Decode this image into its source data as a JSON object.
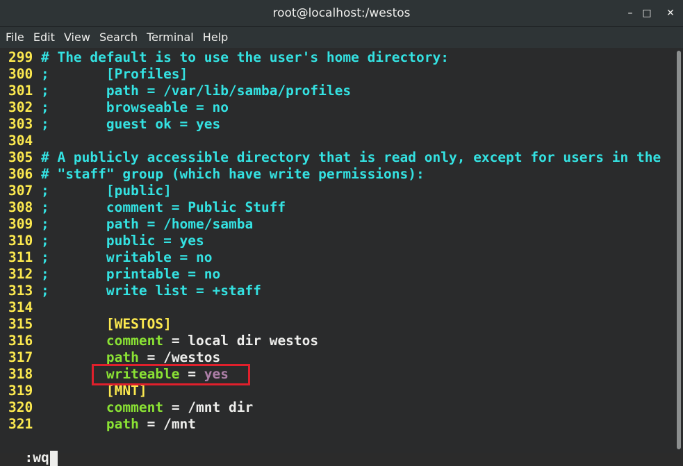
{
  "window": {
    "title": "root@localhost:/westos"
  },
  "menu": [
    "File",
    "Edit",
    "View",
    "Search",
    "Terminal",
    "Help"
  ],
  "lines": [
    {
      "n": "299",
      "segs": [
        {
          "t": "# The default is to use the user's home directory:",
          "c": "comment"
        }
      ]
    },
    {
      "n": "300",
      "segs": [
        {
          "t": ";       [Profiles]",
          "c": "comment"
        }
      ]
    },
    {
      "n": "301",
      "segs": [
        {
          "t": ";       path = /var/lib/samba/profiles",
          "c": "comment"
        }
      ]
    },
    {
      "n": "302",
      "segs": [
        {
          "t": ";       browseable = no",
          "c": "comment"
        }
      ]
    },
    {
      "n": "303",
      "segs": [
        {
          "t": ";       guest ok = yes",
          "c": "comment"
        }
      ]
    },
    {
      "n": "304",
      "segs": []
    },
    {
      "n": "305",
      "segs": [
        {
          "t": "# A publicly accessible directory that is read only, except for users in the",
          "c": "comment"
        }
      ]
    },
    {
      "n": "306",
      "segs": [
        {
          "t": "# \"staff\" group (which have write permissions):",
          "c": "comment"
        }
      ]
    },
    {
      "n": "307",
      "segs": [
        {
          "t": ";       [public]",
          "c": "comment"
        }
      ]
    },
    {
      "n": "308",
      "segs": [
        {
          "t": ";       comment = Public Stuff",
          "c": "comment"
        }
      ]
    },
    {
      "n": "309",
      "segs": [
        {
          "t": ";       path = /home/samba",
          "c": "comment"
        }
      ]
    },
    {
      "n": "310",
      "segs": [
        {
          "t": ";       public = yes",
          "c": "comment"
        }
      ]
    },
    {
      "n": "311",
      "segs": [
        {
          "t": ";       writable = no",
          "c": "comment"
        }
      ]
    },
    {
      "n": "312",
      "segs": [
        {
          "t": ";       printable = no",
          "c": "comment"
        }
      ]
    },
    {
      "n": "313",
      "segs": [
        {
          "t": ";       write list = +staff",
          "c": "comment"
        }
      ]
    },
    {
      "n": "314",
      "segs": []
    },
    {
      "n": "315",
      "segs": [
        {
          "t": "        ",
          "c": "plain"
        },
        {
          "t": "[WESTOS]",
          "c": "section"
        }
      ]
    },
    {
      "n": "316",
      "segs": [
        {
          "t": "        ",
          "c": "plain"
        },
        {
          "t": "comment",
          "c": "key"
        },
        {
          "t": " = local dir westos",
          "c": "plain"
        }
      ]
    },
    {
      "n": "317",
      "segs": [
        {
          "t": "        ",
          "c": "plain"
        },
        {
          "t": "path",
          "c": "key"
        },
        {
          "t": " = /westos",
          "c": "plain"
        }
      ]
    },
    {
      "n": "318",
      "segs": [
        {
          "t": "        ",
          "c": "plain"
        },
        {
          "t": "writeable",
          "c": "key"
        },
        {
          "t": " = ",
          "c": "plain"
        },
        {
          "t": "yes",
          "c": "val"
        }
      ]
    },
    {
      "n": "319",
      "segs": [
        {
          "t": "        ",
          "c": "plain"
        },
        {
          "t": "[MNT]",
          "c": "section"
        }
      ]
    },
    {
      "n": "320",
      "segs": [
        {
          "t": "        ",
          "c": "plain"
        },
        {
          "t": "comment",
          "c": "key"
        },
        {
          "t": " = /mnt dir",
          "c": "plain"
        }
      ]
    },
    {
      "n": "321",
      "segs": [
        {
          "t": "        ",
          "c": "plain"
        },
        {
          "t": "path",
          "c": "key"
        },
        {
          "t": " = /mnt",
          "c": "plain"
        }
      ]
    }
  ],
  "command": ":wq",
  "colors": {
    "comment": "#34e2e2",
    "line_number": "#fce94f",
    "key": "#8ae234",
    "value": "#ad7fa8",
    "highlight": "#e0202c"
  }
}
